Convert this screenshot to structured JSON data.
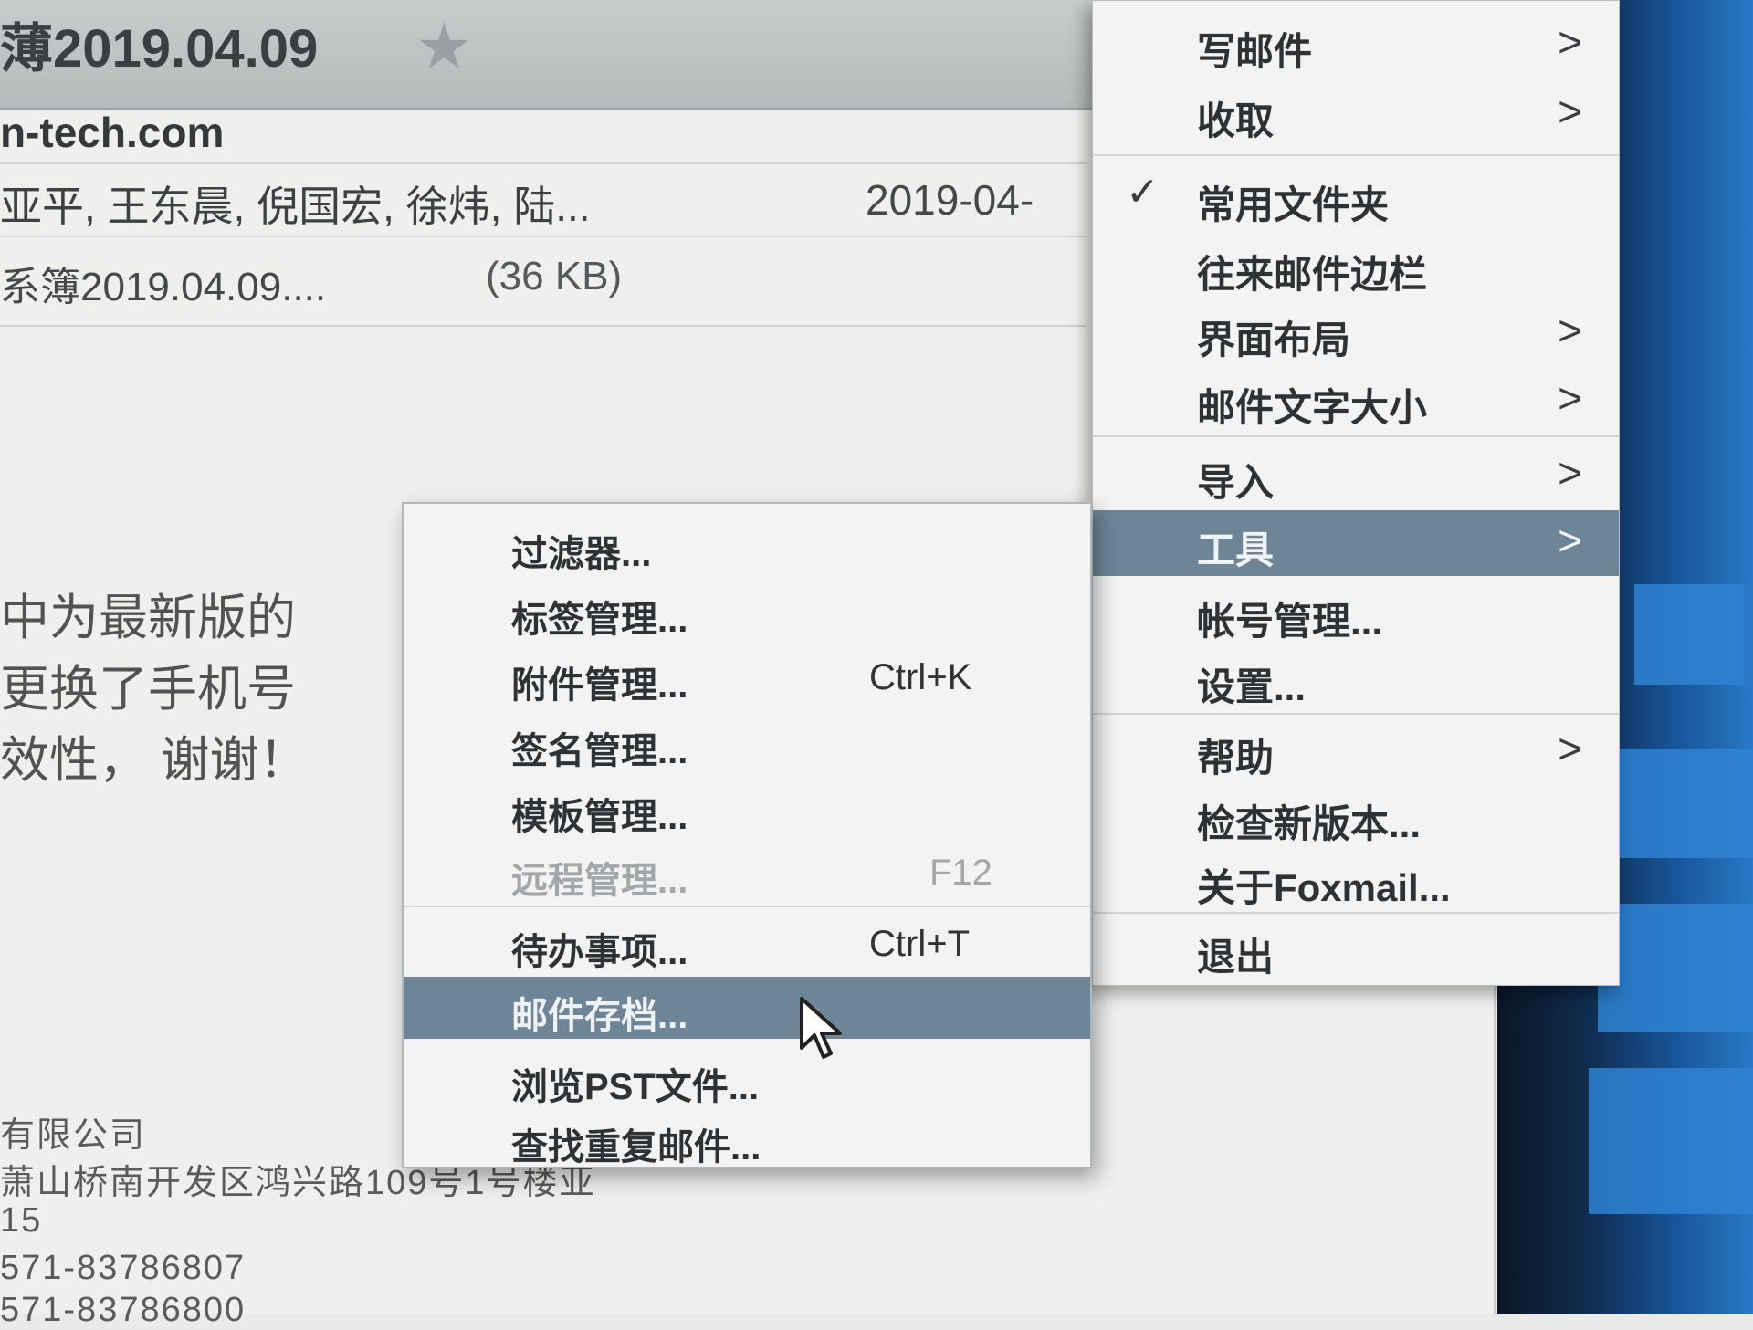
{
  "mail": {
    "subject": "薄2019.04.09",
    "sender": "n-tech.com",
    "recipients": "亚平, 王东晨, 倪国宏, 徐炜, 陆...",
    "date": "2019-04-",
    "attachment_name": "系簿2019.04.09....",
    "attachment_size": "(36 KB)",
    "body_lines": [
      "中为最新版的",
      "更换了手机号",
      "效性，  谢谢！"
    ],
    "signature_lines": [
      "有限公司",
      "萧山桥南开发区鸿兴路109号1号楼亚",
      "15",
      "571-83786807",
      "571-83786800"
    ]
  },
  "main_menu": {
    "items": [
      {
        "label": "写邮件",
        "arrow": ">"
      },
      {
        "label": "收取",
        "arrow": ">"
      },
      {
        "label": "常用文件夹",
        "check": "✓"
      },
      {
        "label": "往来邮件边栏"
      },
      {
        "label": "界面布局",
        "arrow": ">"
      },
      {
        "label": "邮件文字大小",
        "arrow": ">"
      },
      {
        "label": "导入",
        "arrow": ">"
      },
      {
        "label": "工具",
        "arrow": ">",
        "active": true
      },
      {
        "label": "帐号管理..."
      },
      {
        "label": "设置..."
      },
      {
        "label": "帮助",
        "arrow": ">"
      },
      {
        "label": "检查新版本..."
      },
      {
        "label": "关于Foxmail..."
      },
      {
        "label": "退出"
      }
    ]
  },
  "tools_menu": {
    "items": [
      {
        "label": "过滤器..."
      },
      {
        "label": "标签管理..."
      },
      {
        "label": "附件管理...",
        "shortcut": "Ctrl+K"
      },
      {
        "label": "签名管理..."
      },
      {
        "label": "模板管理..."
      },
      {
        "label": "远程管理...",
        "shortcut": "F12",
        "disabled": true
      },
      {
        "label": "待办事项...",
        "shortcut": "Ctrl+T"
      },
      {
        "label": "邮件存档...",
        "active": true
      },
      {
        "label": "浏览PST文件..."
      },
      {
        "label": "查找重复邮件..."
      }
    ]
  },
  "icons": {
    "star": "star-icon",
    "check": "check-icon",
    "arrow": "chevron-right-icon",
    "cursor": "mouse-cursor-icon"
  },
  "colors": {
    "highlight": "#6e8597",
    "menu_bg": "#f2f3f2"
  }
}
